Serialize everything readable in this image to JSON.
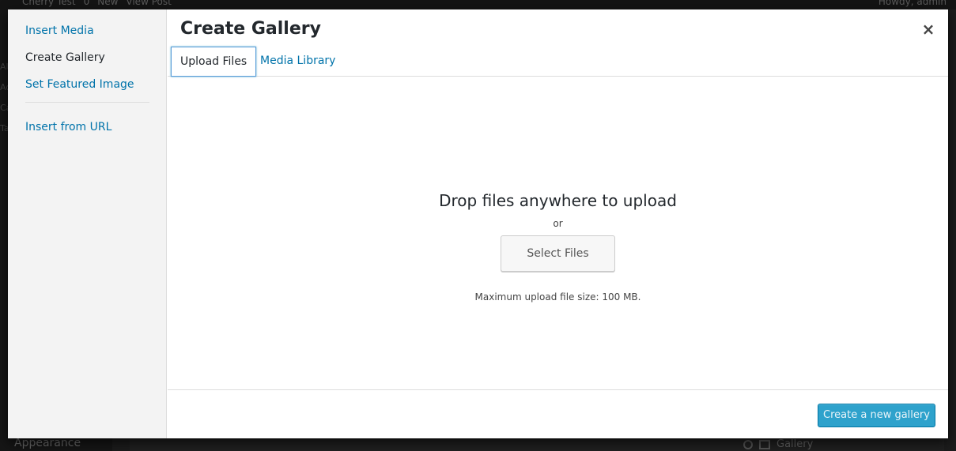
{
  "admin_bar": {
    "site_name": "Cherry Test",
    "comments": "0",
    "new_label": "New",
    "view_post": "View Post",
    "greeting": "Howdy, admin"
  },
  "background": {
    "sidebar_strip": [
      "All",
      "Ad",
      "Ca",
      "Tag"
    ],
    "appearance_label": "Appearance",
    "gallery_label": "Gallery"
  },
  "modal": {
    "title": "Create Gallery",
    "close_symbol": "×",
    "menu": [
      {
        "label": "Insert Media"
      },
      {
        "label": "Create Gallery",
        "active": true
      },
      {
        "label": "Set Featured Image"
      },
      {
        "label": "Insert from URL"
      }
    ],
    "tabs": [
      {
        "label": "Upload Files",
        "active": true
      },
      {
        "label": "Media Library"
      }
    ],
    "uploader": {
      "drop_text": "Drop files anywhere to upload",
      "or_text": "or",
      "select_button": "Select Files",
      "max_size_text": "Maximum upload file size: 100 MB."
    },
    "toolbar": {
      "primary_button": "Create a new gallery"
    }
  },
  "colors": {
    "link": "#0073aa",
    "primary_button": "#2ea2cc",
    "overlay": "#1c1c1c"
  }
}
